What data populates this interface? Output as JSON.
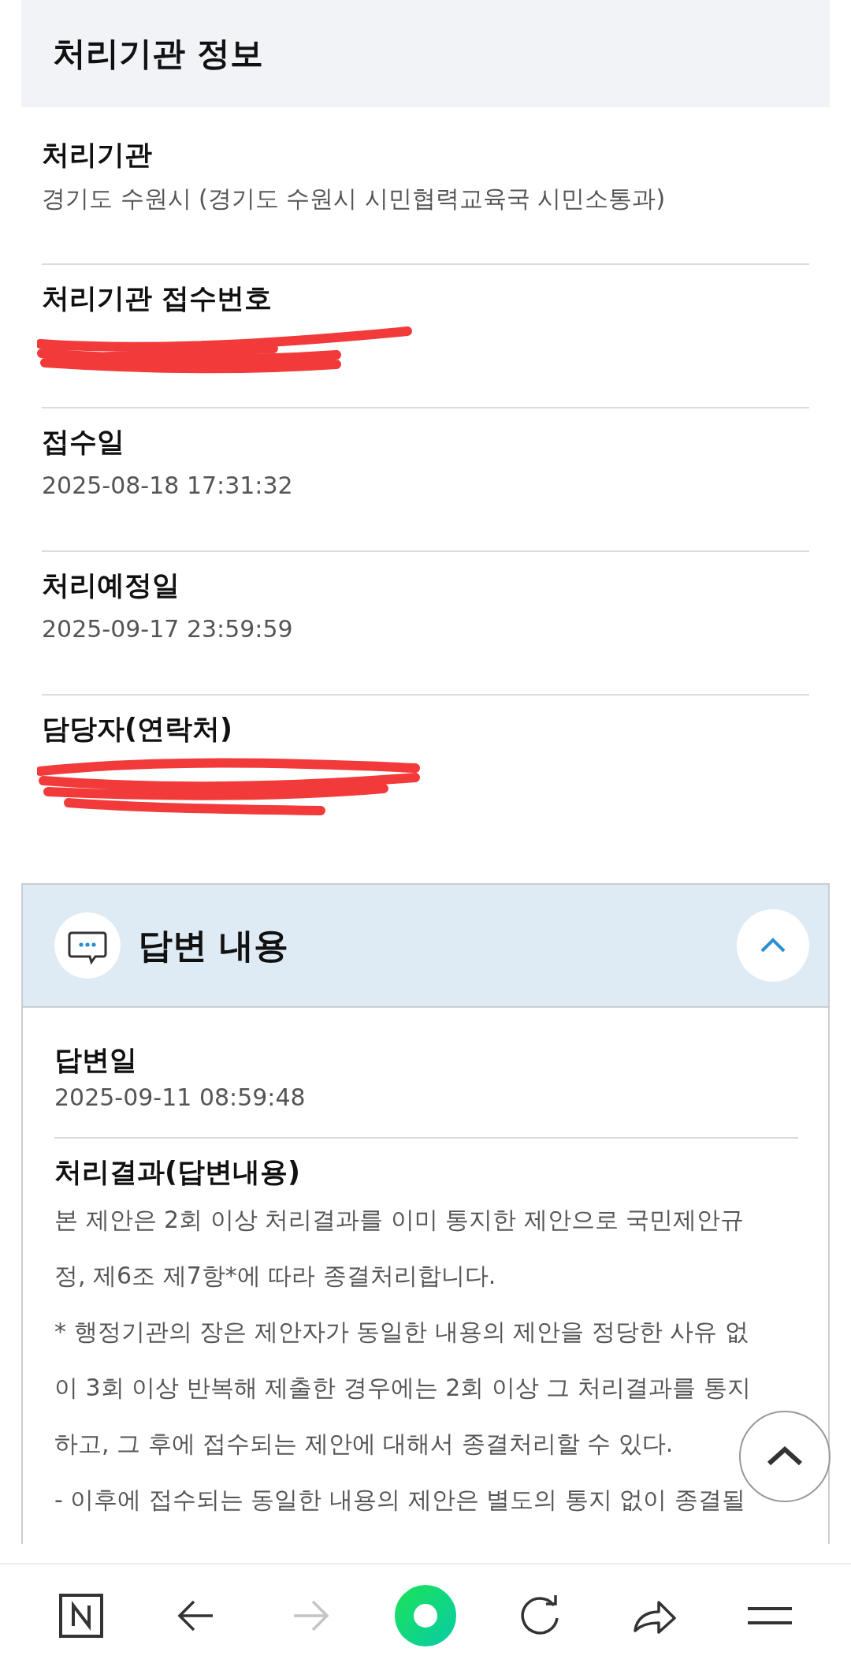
{
  "section_header": {
    "title": "처리기관 정보"
  },
  "fields": [
    {
      "kind": "text",
      "label": "처리기관",
      "value": "경기도 수원시 (경기도 수원시 시민협력교육국 시민소통과)"
    },
    {
      "kind": "redacted",
      "label": "처리기관 접수번호"
    },
    {
      "kind": "text",
      "label": "접수일",
      "value": "2025-08-18 17:31:32"
    },
    {
      "kind": "text",
      "label": "처리예정일",
      "value": "2025-09-17 23:59:59"
    },
    {
      "kind": "redacted",
      "label": "담당자(연락처)"
    }
  ],
  "answer_panel": {
    "title": "답변 내용",
    "expanded": true,
    "answer_date": {
      "label": "답변일",
      "value": "2025-09-11 08:59:48"
    },
    "result": {
      "label": "처리결과(답변내용)",
      "lines": [
        "본 제안은 2회 이상 처리결과를 이미 통지한 제안으로 국민제안규",
        "정, 제6조 제7항*에 따라 종결처리합니다.",
        "* 행정기관의 장은 제안자가 동일한 내용의 제안을 정당한 사유 없",
        "이 3회 이상 반복해 제출한 경우에는 2회 이상 그 처리결과를 통지",
        "하고, 그 후에 접수되는 제안에 대해서 종결처리할 수 있다.",
        "- 이후에 접수되는 동일한 내용의 제안은 별도의 통지 없이 종결될"
      ]
    }
  },
  "browser_toolbar": {
    "forward_disabled": true
  }
}
